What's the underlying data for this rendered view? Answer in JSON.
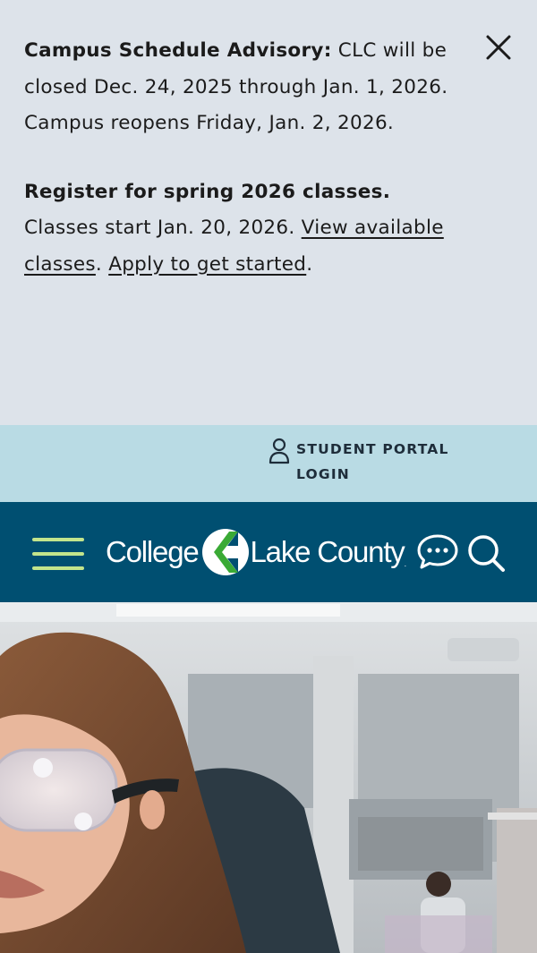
{
  "advisory": {
    "schedule_heading": "Campus Schedule Advisory:",
    "schedule_text": " CLC will be closed Dec. 24, 2025 through Jan. 1, 2026. Campus reopens Friday, Jan. 2, 2026.",
    "register_heading": "Register for spring 2026 classes.",
    "register_text": " Classes start Jan. 20, 2026. ",
    "view_link": "View available classes",
    "separator": ". ",
    "apply_link": "Apply to get started",
    "end_punct": "."
  },
  "utility": {
    "portal_label": "STUDENT PORTAL LOGIN",
    "portal_icon": "user-icon"
  },
  "nav": {
    "logo_left": "College",
    "logo_right": "Lake County",
    "logo_tm": ".",
    "menu_icon": "hamburger-menu-icon",
    "chat_icon": "chat-icon",
    "search_icon": "search-icon"
  },
  "colors": {
    "advisory_bg": "#dde3ea",
    "utility_bg": "#b9dbe4",
    "nav_bg": "#004f71",
    "accent_green": "#c3e58c",
    "logo_green": "#3aaa35"
  }
}
